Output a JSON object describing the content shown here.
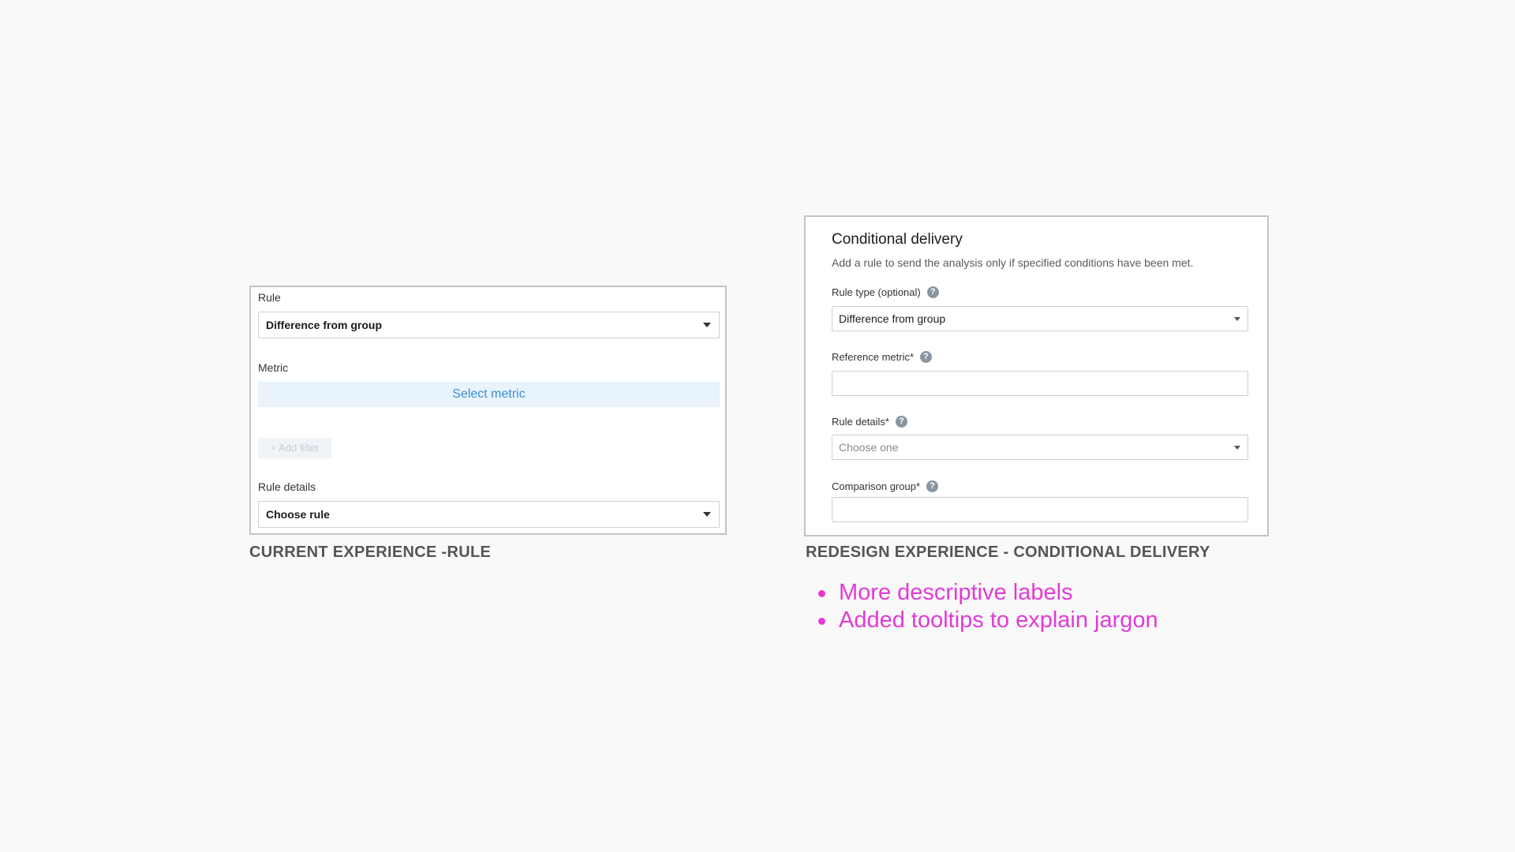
{
  "current": {
    "rule_label": "Rule",
    "rule_value": "Difference from group",
    "metric_label": "Metric",
    "select_metric_label": "Select metric",
    "add_filter_label": "+ Add filter",
    "rule_details_label": "Rule details",
    "rule_details_value": "Choose rule",
    "caption": "CURRENT EXPERIENCE -RULE"
  },
  "redesign": {
    "title": "Conditional delivery",
    "description": "Add a rule to send the analysis only if specified conditions have been met.",
    "rule_type_label": "Rule type (optional)",
    "rule_type_value": "Difference from group",
    "reference_metric_label": "Reference metric*",
    "reference_metric_value": "",
    "rule_details_label": "Rule details*",
    "rule_details_placeholder": "Choose one",
    "comparison_group_label": "Comparison group*",
    "comparison_group_value": "",
    "help_glyph": "?",
    "caption": "REDESIGN EXPERIENCE - CONDITIONAL DELIVERY"
  },
  "notes": [
    "More descriptive labels",
    "Added tooltips to explain jargon"
  ],
  "colors": {
    "background": "#f9f9f9",
    "accent_blue": "#3b8ed6",
    "note_magenta": "#e23ad6",
    "help_icon_gray": "#8a95a1"
  },
  "icons": [
    "chevron-down-icon",
    "help-icon"
  ]
}
